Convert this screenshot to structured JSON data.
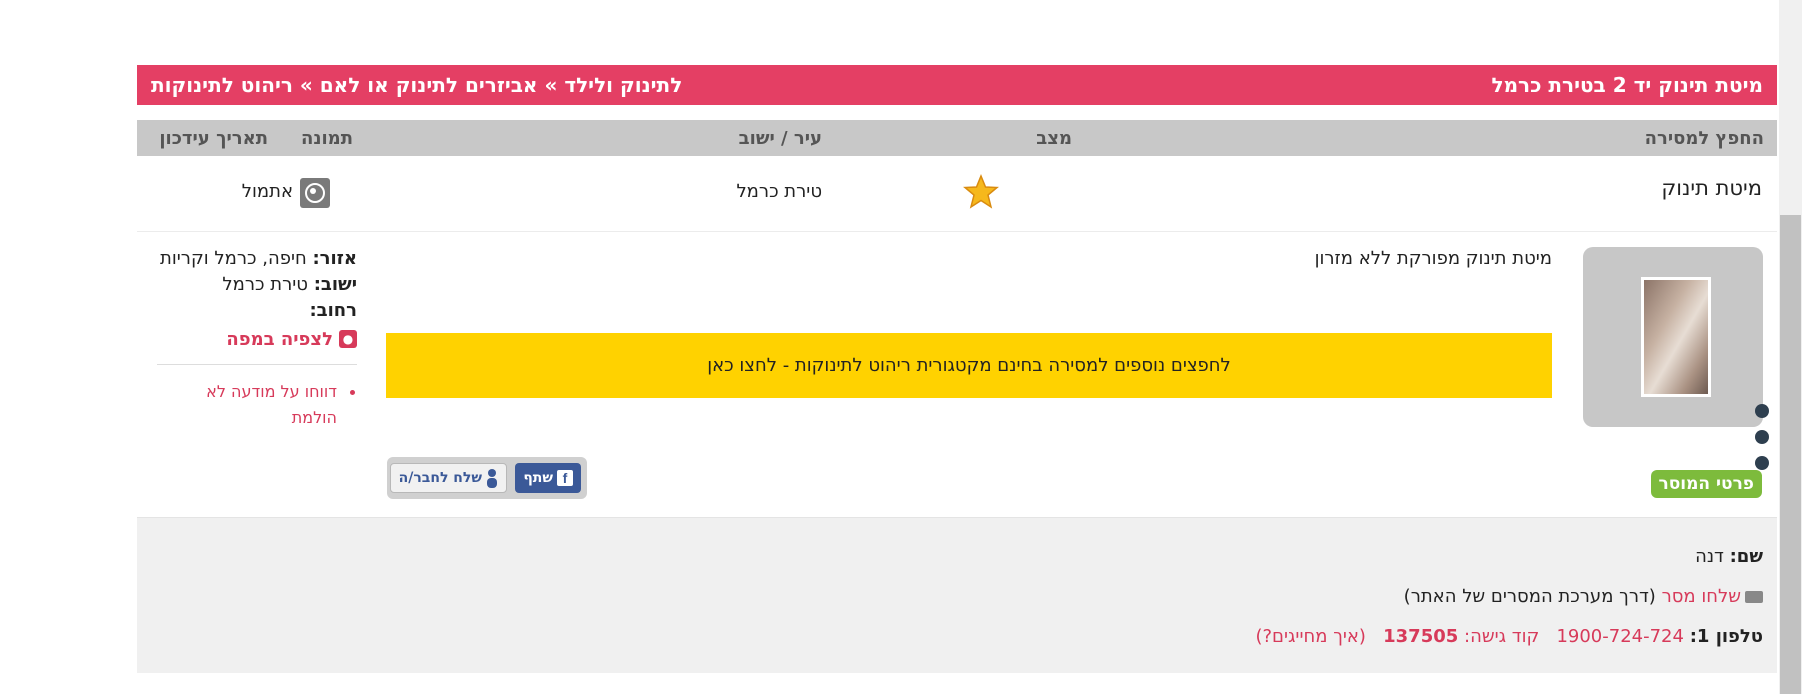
{
  "header": {
    "title": "מיטת תינוק יד 2 בטירת כרמל",
    "breadcrumb": "לתינוק ולילד » אביזרים לתינוק או לאם » ריהוט לתינוקות"
  },
  "columns": {
    "item": "החפץ למסירה",
    "condition": "מצב",
    "city": "עיר / ישוב",
    "image": "תמונה",
    "updated": "תאריך עידכון"
  },
  "item": {
    "name": "מיטת תינוק",
    "condition_icon": "star-icon",
    "city": "טירת כרמל",
    "image_icon": "camera-icon",
    "updated": "אתמול"
  },
  "details": {
    "description": "מיטת תינוק מפורקת ללא מזרון",
    "banner": "לחפצים נוספים למסירה בחינם מקטגורית ריהוט לתינוקות - לחצו כאן",
    "giver_button": "פרטי המוסר",
    "share_label": "שתף",
    "send_friend_label": "שלח לחבר/ה"
  },
  "location": {
    "area_label": "אזור:",
    "area_value": "חיפה, כרמל וקריות",
    "city_label": "ישוב:",
    "city_value": "טירת כרמל",
    "street_label": "רחוב:",
    "map_link": "לצפיה במפה",
    "report_line1": "דווחו על מודעה לא",
    "report_line2": "הולמת"
  },
  "contact": {
    "name_label": "שם:",
    "name_value": "דנה",
    "send_message": "שלחו מסר",
    "send_message_note": "(דרך מערכת המסרים של האתר)",
    "phone_label": "טלפון 1:",
    "phone_number": "1900-724-724",
    "access_code_label": "קוד גישה:",
    "access_code": "137505",
    "charges_link": "(איך מחייגים?)"
  },
  "colors": {
    "title_bar": "#e43f64",
    "banner": "#ffd200",
    "giver_button": "#7dbb3c",
    "link": "#d73a5a",
    "facebook": "#3b5998"
  }
}
